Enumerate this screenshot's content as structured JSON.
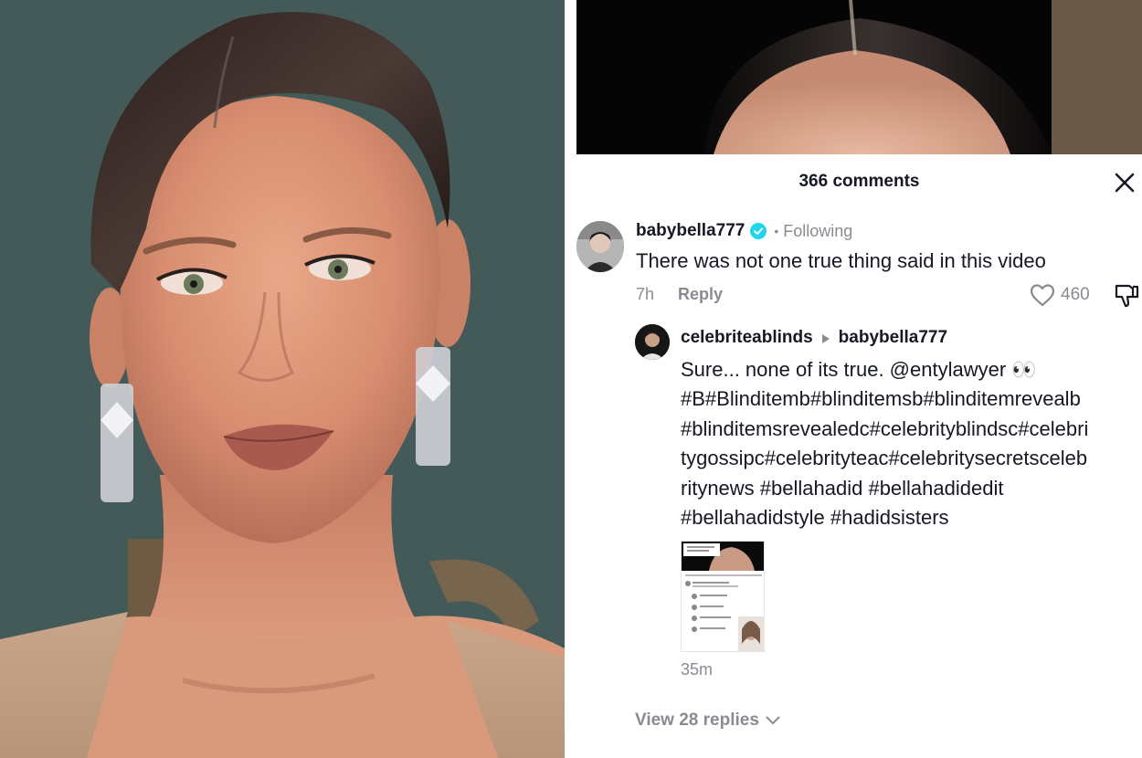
{
  "colors": {
    "text_primary": "#161823",
    "text_secondary": "#8a8b91",
    "verified_badge": "#20d5ec",
    "background": "#ffffff"
  },
  "icons": {
    "close": "close-icon",
    "verified": "verified-badge-icon",
    "like": "heart-outline-icon",
    "dislike": "thumbs-down-icon",
    "reply_arrow": "triangle-right-icon",
    "chevron": "chevron-down-icon"
  },
  "comments": {
    "count_label": "366 comments",
    "items": [
      {
        "username": "babybella777",
        "verified": true,
        "status": "Following",
        "text": "There was not one true thing said in this video",
        "time": "7h",
        "reply_label": "Reply",
        "likes": "460",
        "replies": [
          {
            "username": "celebriteablinds",
            "reply_to": "babybella777",
            "text": "Sure... none of its true. @entylawyer 👀\n#B#Blinditemb#blinditemsb#blinditemrevealb\n#blinditemsrevealedc#celebrityblindsc#celebri\ntygossipc#celebrityteac#celebritysecretsceleb\nritynews #bellahadid #bellahadidedit\n#bellahadidstyle #hadidsisters",
            "time": "35m"
          }
        ],
        "view_replies_label": "View 28 replies"
      }
    ]
  }
}
